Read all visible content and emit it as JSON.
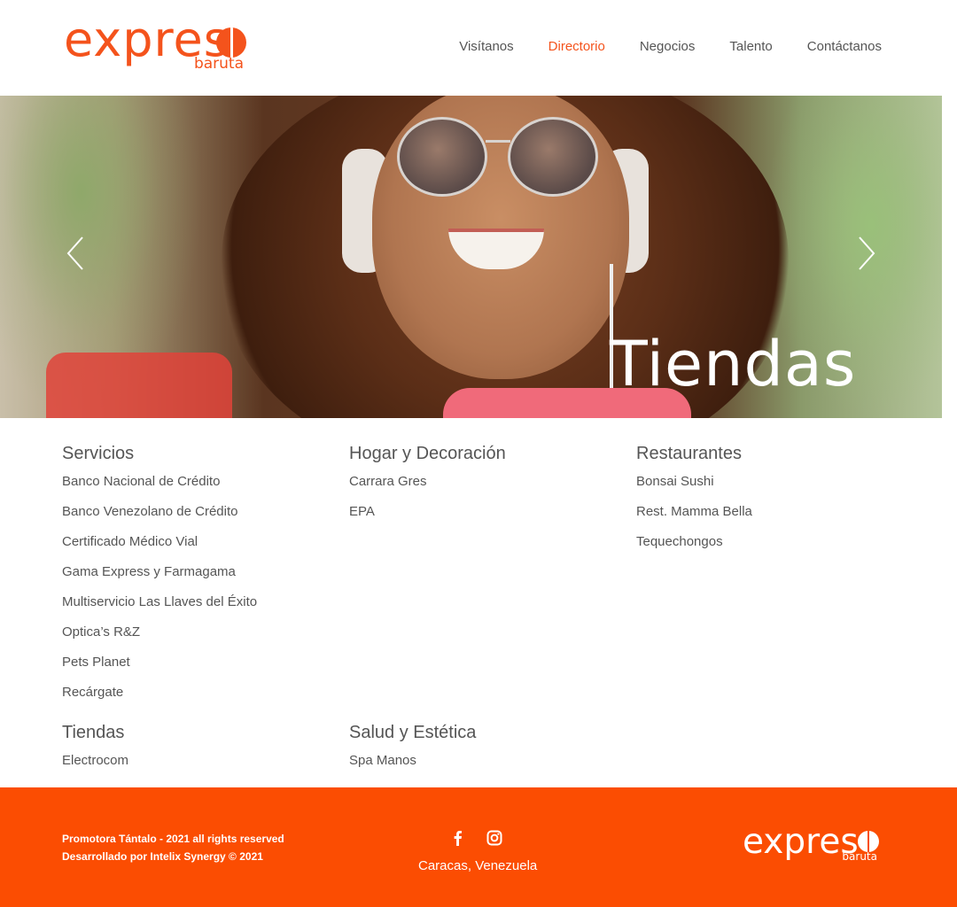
{
  "brand": {
    "wordmark": "expres",
    "sub": "baruta",
    "color": "#f4531c"
  },
  "nav": {
    "items": [
      {
        "label": "Visítanos"
      },
      {
        "label": "Directorio",
        "active": true
      },
      {
        "label": "Negocios"
      },
      {
        "label": "Talento"
      },
      {
        "label": "Contáctanos"
      }
    ]
  },
  "hero": {
    "title": "Tiendas",
    "prev_icon": "chevron-left-icon",
    "next_icon": "chevron-right-icon"
  },
  "directory": {
    "servicios": {
      "title": "Servicios",
      "items": [
        "Banco Nacional de Crédito",
        "Banco Venezolano de Crédito",
        "Certificado Médico Vial",
        "Gama Express y Farmagama",
        "Multiservicio Las Llaves del Éxito",
        "Optica’s R&Z",
        "Pets Planet",
        "Recárgate"
      ]
    },
    "hogar": {
      "title": "Hogar y Decoración",
      "items": [
        "Carrara Gres",
        "EPA"
      ]
    },
    "restaurantes": {
      "title": "Restaurantes",
      "items": [
        "Bonsai Sushi",
        "Rest. Mamma Bella",
        "Tequechongos"
      ]
    },
    "tiendas": {
      "title": "Tiendas",
      "items": [
        "Electrocom"
      ]
    },
    "salud": {
      "title": "Salud y Estética",
      "items": [
        "Spa Manos"
      ]
    }
  },
  "footer": {
    "copyright": "Promotora Tántalo - 2021 all rights reserved",
    "developer": "Desarrollado por Intelix Synergy © 2021",
    "city": "Caracas, Venezuela",
    "social": [
      "facebook-icon",
      "instagram-icon"
    ],
    "bg_color": "#fb4d02"
  }
}
